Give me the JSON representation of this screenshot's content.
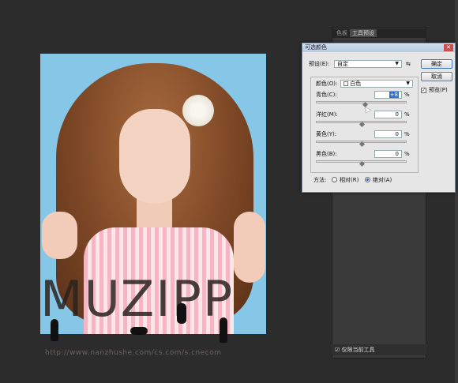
{
  "photo": {
    "watermark": "MUZIPP",
    "url": "http://www.nanzhushe.com/cs.com/s.cnecom"
  },
  "panel": {
    "tabs": [
      "色板",
      "工具预设"
    ],
    "footer_label": "仅限当前工具"
  },
  "dialog": {
    "title": "可选颜色",
    "preset_label": "预设(E):",
    "preset_value": "自定",
    "colors_label": "颜色(O):",
    "colors_value": "白色",
    "percent": "%",
    "sliders": [
      {
        "label": "青色(C):",
        "value": "+8"
      },
      {
        "label": "洋红(M):",
        "value": "0"
      },
      {
        "label": "黄色(Y):",
        "value": "0"
      },
      {
        "label": "黑色(B):",
        "value": "0"
      }
    ],
    "method_label": "方法:",
    "method_relative": "相对(R)",
    "method_absolute": "绝对(A)",
    "method_selected": "绝对(A)",
    "ok": "确定",
    "cancel": "取消",
    "preview": "预览(P)",
    "preview_checked": true
  }
}
